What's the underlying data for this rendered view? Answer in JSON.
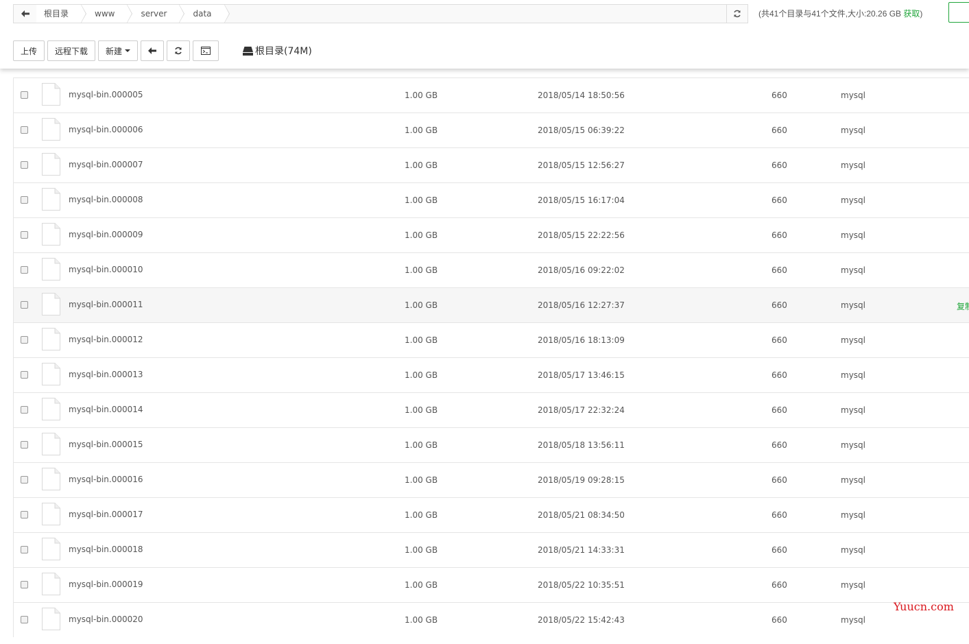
{
  "breadcrumb": [
    "根目录",
    "www",
    "server",
    "data"
  ],
  "summary": {
    "text": "(共41个目录与41个文件,大小:20.26 GB",
    "link": "获取",
    "close": ")"
  },
  "toolbar": {
    "upload": "上传",
    "remote_download": "远程下载",
    "new": "新建",
    "disk_label": "根目录(74M)"
  },
  "files": [
    {
      "name": "mysql-bin.000005",
      "size": "1.00 GB",
      "mtime": "2018/05/14 18:50:56",
      "perm": "660",
      "owner": "mysql"
    },
    {
      "name": "mysql-bin.000006",
      "size": "1.00 GB",
      "mtime": "2018/05/15 06:39:22",
      "perm": "660",
      "owner": "mysql"
    },
    {
      "name": "mysql-bin.000007",
      "size": "1.00 GB",
      "mtime": "2018/05/15 12:56:27",
      "perm": "660",
      "owner": "mysql"
    },
    {
      "name": "mysql-bin.000008",
      "size": "1.00 GB",
      "mtime": "2018/05/15 16:17:04",
      "perm": "660",
      "owner": "mysql"
    },
    {
      "name": "mysql-bin.000009",
      "size": "1.00 GB",
      "mtime": "2018/05/15 22:22:56",
      "perm": "660",
      "owner": "mysql"
    },
    {
      "name": "mysql-bin.000010",
      "size": "1.00 GB",
      "mtime": "2018/05/16 09:22:02",
      "perm": "660",
      "owner": "mysql"
    },
    {
      "name": "mysql-bin.000011",
      "size": "1.00 GB",
      "mtime": "2018/05/16 12:27:37",
      "perm": "660",
      "owner": "mysql",
      "action": "复制",
      "hover": true
    },
    {
      "name": "mysql-bin.000012",
      "size": "1.00 GB",
      "mtime": "2018/05/16 18:13:09",
      "perm": "660",
      "owner": "mysql"
    },
    {
      "name": "mysql-bin.000013",
      "size": "1.00 GB",
      "mtime": "2018/05/17 13:46:15",
      "perm": "660",
      "owner": "mysql"
    },
    {
      "name": "mysql-bin.000014",
      "size": "1.00 GB",
      "mtime": "2018/05/17 22:32:24",
      "perm": "660",
      "owner": "mysql"
    },
    {
      "name": "mysql-bin.000015",
      "size": "1.00 GB",
      "mtime": "2018/05/18 13:56:11",
      "perm": "660",
      "owner": "mysql"
    },
    {
      "name": "mysql-bin.000016",
      "size": "1.00 GB",
      "mtime": "2018/05/19 09:28:15",
      "perm": "660",
      "owner": "mysql"
    },
    {
      "name": "mysql-bin.000017",
      "size": "1.00 GB",
      "mtime": "2018/05/21 08:34:50",
      "perm": "660",
      "owner": "mysql"
    },
    {
      "name": "mysql-bin.000018",
      "size": "1.00 GB",
      "mtime": "2018/05/21 14:33:31",
      "perm": "660",
      "owner": "mysql"
    },
    {
      "name": "mysql-bin.000019",
      "size": "1.00 GB",
      "mtime": "2018/05/22 10:35:51",
      "perm": "660",
      "owner": "mysql"
    },
    {
      "name": "mysql-bin.000020",
      "size": "1.00 GB",
      "mtime": "2018/05/22 15:42:43",
      "perm": "660",
      "owner": "mysql"
    }
  ],
  "watermark": "Yuucn.com",
  "colors": {
    "accent": "#20a53a",
    "watermark": "#d9161c",
    "border": "#e5e5e5"
  }
}
